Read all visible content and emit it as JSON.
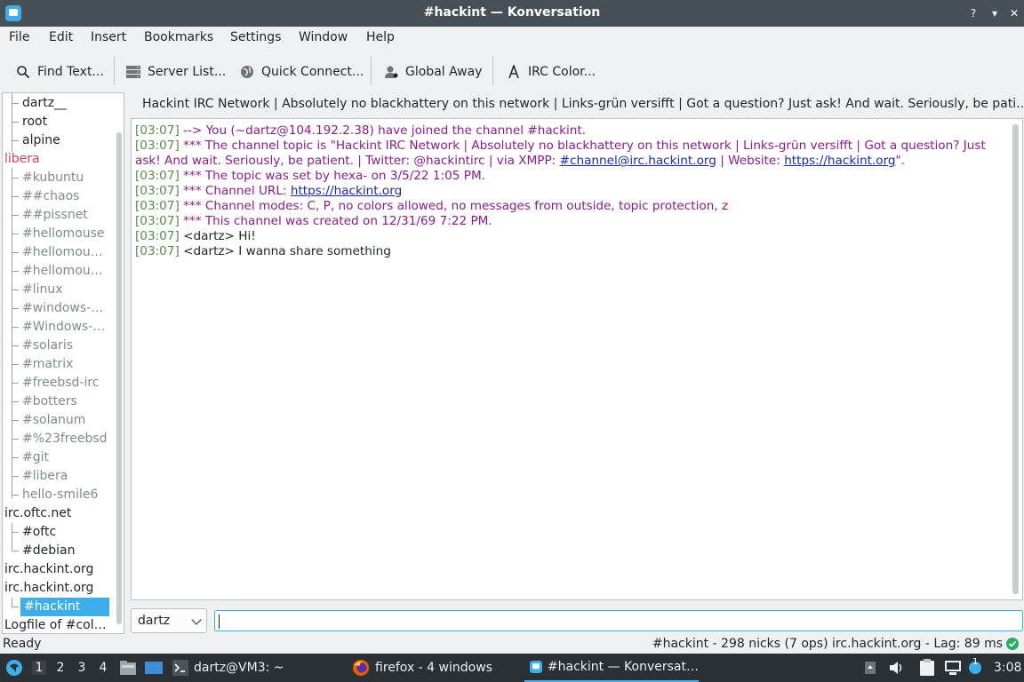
{
  "window": {
    "title": "#hackint — Konversation"
  },
  "menu": [
    "File",
    "Edit",
    "Insert",
    "Bookmarks",
    "Settings",
    "Window",
    "Help"
  ],
  "toolbar": {
    "find": "Find Text...",
    "server_list": "Server List...",
    "quick_connect": "Quick Connect...",
    "global_away": "Global Away",
    "irc_color": "IRC Color..."
  },
  "tree": [
    {
      "label": "dartz__",
      "kind": "child-active"
    },
    {
      "label": "root",
      "kind": "child-active"
    },
    {
      "label": "alpine",
      "kind": "child-active"
    },
    {
      "label": "libera",
      "kind": "server-red"
    },
    {
      "label": "#kubuntu",
      "kind": "child"
    },
    {
      "label": "##chaos",
      "kind": "child"
    },
    {
      "label": "##pissnet",
      "kind": "child"
    },
    {
      "label": "#hellomouse",
      "kind": "child"
    },
    {
      "label": "#hellomou…",
      "kind": "child"
    },
    {
      "label": "#hellomou…",
      "kind": "child"
    },
    {
      "label": "#linux",
      "kind": "child"
    },
    {
      "label": "#windows-…",
      "kind": "child"
    },
    {
      "label": "#Windows-…",
      "kind": "child"
    },
    {
      "label": "#solaris",
      "kind": "child"
    },
    {
      "label": "#matrix",
      "kind": "child"
    },
    {
      "label": "#freebsd-irc",
      "kind": "child"
    },
    {
      "label": "#botters",
      "kind": "child"
    },
    {
      "label": "#solanum",
      "kind": "child"
    },
    {
      "label": "#%23freebsd",
      "kind": "child"
    },
    {
      "label": "#git",
      "kind": "child"
    },
    {
      "label": "#libera",
      "kind": "child"
    },
    {
      "label": "hello-smile6",
      "kind": "child"
    },
    {
      "label": "irc.oftc.net",
      "kind": "server"
    },
    {
      "label": "#oftc",
      "kind": "child-active"
    },
    {
      "label": "#debian",
      "kind": "child-active"
    },
    {
      "label": "irc.hackint.org",
      "kind": "server"
    },
    {
      "label": "irc.hackint.org",
      "kind": "server"
    },
    {
      "label": "#hackint",
      "kind": "selected"
    },
    {
      "label": "Logfile of #col…",
      "kind": "server"
    }
  ],
  "topic": "Hackint IRC Network | Absolutely no blackhattery on this network | Links-grün versifft | Got a question? Just ask! And wait. Seriously, be pati…",
  "chat": {
    "l1_ts": "[03:07]",
    "l1_text": "--> You (~dartz@104.192.2.38) have joined the channel #hackint.",
    "l2_ts": "[03:07]",
    "l2_text_a": "*** The channel topic is \"Hackint IRC Network | Absolutely no blackhattery on this network | Links-grün versifft | Got a question? Just ask! And wait. Seriously, be patient. | Twitter: @hackintirc | via XMPP: ",
    "l2_link1": "#channel@irc.hackint.org",
    "l2_text_b": " | Website: ",
    "l2_link2": "https://hackint.org",
    "l2_text_c": "\".",
    "l3_ts": "[03:07]",
    "l3_text": "*** The topic was set by hexa- on 3/5/22 1:05 PM.",
    "l4_ts": "[03:07]",
    "l4_text": "*** Channel URL: ",
    "l4_link": "https://hackint.org",
    "l5_ts": "[03:07]",
    "l5_text": "*** Channel modes: C, P, no colors allowed, no messages from outside, topic protection, z",
    "l6_ts": "[03:07]",
    "l6_text": "*** This channel was created on 12/31/69 7:22 PM.",
    "l7_ts": "[03:07]",
    "l7_text": "<dartz> Hi!",
    "l8_ts": "[03:07]",
    "l8_text": "<dartz> I wanna share something"
  },
  "input": {
    "nick": "dartz",
    "value": ""
  },
  "status": {
    "left": "Ready",
    "right": "#hackint - 298 nicks (7 ops)  irc.hackint.org - Lag: 89 ms"
  },
  "taskbar": {
    "desktops": [
      "1",
      "2",
      "3",
      "4"
    ],
    "terminal": "dartz@VM3: ~",
    "firefox": "firefox - 4 windows",
    "konversation": "#hackint — Konversat…",
    "notif_count": "1",
    "clock": "3:08"
  },
  "colors": {
    "accent": "#3daee9",
    "topic_msg": "#8e1c8e",
    "timestamp": "#5a8a4e",
    "server_alert": "#da4453"
  }
}
